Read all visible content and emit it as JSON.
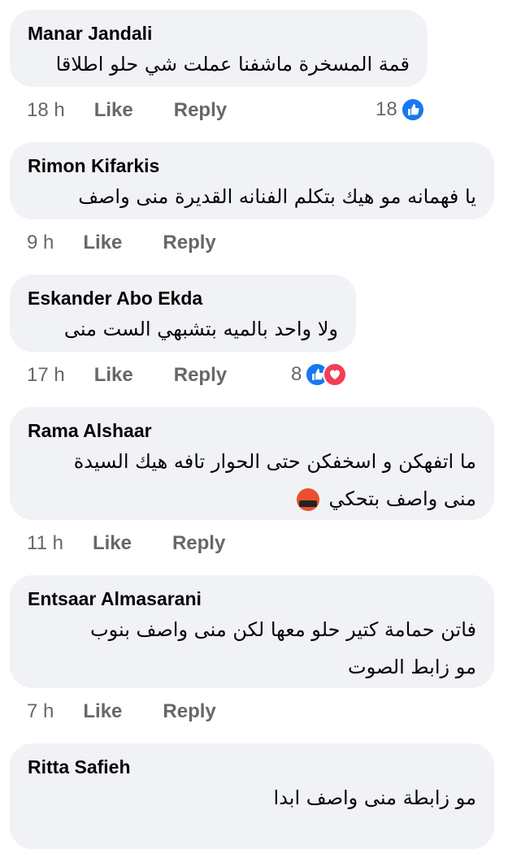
{
  "comments": [
    {
      "author": "Manar Jandali",
      "lines": [
        "قمة المسخرة ماشفنا عملت شي حلو اطلاقا"
      ],
      "time": "18 h",
      "like": "Like",
      "reply": "Reply",
      "reaction_count": "18",
      "reaction_icons": [
        "like-icon"
      ]
    },
    {
      "author": "Rimon Kifarkis",
      "lines": [
        "يا فهمانه مو هيك بتكلم الفنانه القديرة منى واصف"
      ],
      "time": "9 h",
      "like": "Like",
      "reply": "Reply"
    },
    {
      "author": "Eskander Abo Ekda",
      "lines": [
        "ولا واحد بالميه بتشبهي الست منى"
      ],
      "time": "17 h",
      "like": "Like",
      "reply": "Reply",
      "reaction_count": "8",
      "reaction_icons": [
        "like-icon",
        "love-icon"
      ]
    },
    {
      "author": "Rama Alshaar",
      "lines": [
        "ما اتفهكن و اسخفكن حتى الحوار تافه هيك السيدة",
        "منى واصف بتحكي"
      ],
      "emoji": "face-with-symbols-on-mouth-emoji",
      "time": "11 h",
      "like": "Like",
      "reply": "Reply"
    },
    {
      "author": "Entsaar Almasarani",
      "lines": [
        "فاتن حمامة كتير حلو معها لكن منى واصف بنوب",
        "مو زابط الصوت"
      ],
      "time": "7 h",
      "like": "Like",
      "reply": "Reply"
    },
    {
      "author": "Ritta Safieh",
      "lines": [
        "مو زابطة منى واصف ابدا"
      ]
    }
  ],
  "colors": {
    "bubble": "#f0f2f5",
    "meta": "#65676b",
    "like_blue": "#1877f2",
    "love_red": "#f33e58"
  }
}
